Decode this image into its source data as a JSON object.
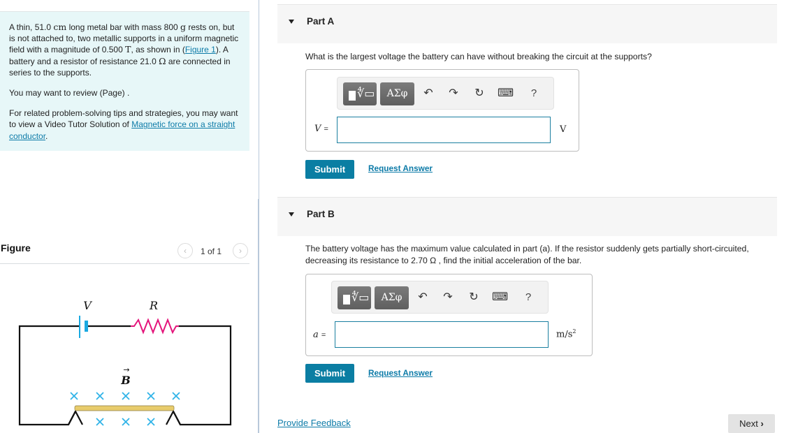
{
  "intro": {
    "p1_a": "A thin, 51.0 ",
    "p1_unit_cm": "cm",
    "p1_b": " long metal bar with mass 800 ",
    "p1_unit_g": "g",
    "p1_c": " rests on, but is not attached to, two metallic supports in a uniform magnetic field with a magnitude of 0.500 ",
    "p1_unit_T": "T",
    "p1_d": ", as shown in (",
    "figure_link": "Figure 1",
    "p1_e": "). A battery and a resistor of resistance 21.0 ",
    "p1_unit_ohm": "Ω",
    "p1_f": " are connected in series to the supports.",
    "p2": "You may want to review (Page) .",
    "p3_a": "For related problem-solving tips and strategies, you may want to view a Video Tutor Solution of ",
    "p3_link": "Magnetic force on a straight conductor",
    "p3_b": "."
  },
  "figure": {
    "title": "Figure",
    "pager_text": "1 of 1",
    "prev_icon": "‹",
    "next_icon": "›",
    "labels": {
      "battery": "V",
      "resistor": "R",
      "field": "B"
    },
    "colors": {
      "wire": "#111111",
      "battery": "#1aa9e1",
      "resistor": "#e4157b",
      "field_marks": "#2fb3e8",
      "bar": "#e8cc6c"
    }
  },
  "partA": {
    "title": "Part A",
    "question": "What is the largest voltage the battery can have without breaking the circuit at the supports?",
    "variable": "V",
    "equals": "=",
    "input_value": "",
    "unit": "V",
    "submit_label": "Submit",
    "request_label": "Request Answer"
  },
  "partB": {
    "title": "Part B",
    "question": "The battery voltage has the maximum value calculated in part (a). If the resistor suddenly gets partially short-circuited, decreasing its resistance to 2.70 Ω , find the initial acceleration of the bar.",
    "variable": "a",
    "equals": "=",
    "input_value": "",
    "unit_base": "m/s",
    "unit_exp": "2",
    "submit_label": "Submit",
    "request_label": "Request Answer"
  },
  "toolbar": {
    "greek_label": "ΑΣφ",
    "template_radical": "∜▭",
    "undo_icon": "↶",
    "redo_icon": "↷",
    "reset_icon": "↻",
    "keyboard_icon": "⌨",
    "help_label": "?"
  },
  "footer": {
    "feedback_label": "Provide Feedback",
    "next_label": "Next",
    "next_chevron": "›"
  },
  "colors": {
    "accent": "#0b7ea3",
    "link": "#0d7ba8",
    "intro_bg": "#e7f7f8",
    "part_header_bg": "#f6f6f6"
  }
}
